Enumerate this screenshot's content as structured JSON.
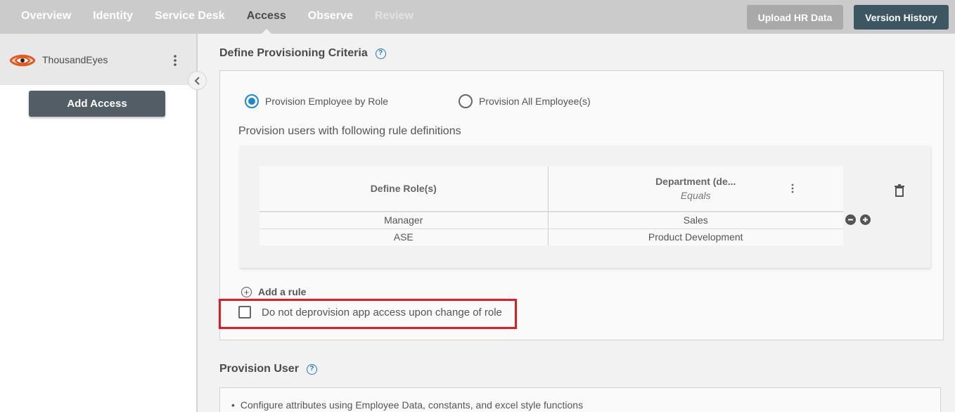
{
  "nav": {
    "items": [
      {
        "label": "Overview",
        "state": "normal"
      },
      {
        "label": "Identity",
        "state": "normal"
      },
      {
        "label": "Service Desk",
        "state": "normal"
      },
      {
        "label": "Access",
        "state": "active"
      },
      {
        "label": "Observe",
        "state": "normal"
      },
      {
        "label": "Review",
        "state": "disabled"
      }
    ],
    "upload_label": "Upload HR Data",
    "version_label": "Version History"
  },
  "sidebar": {
    "app_name": "ThousandEyes",
    "app_logo_icon": "eye-icon",
    "add_access_label": "Add Access"
  },
  "criteria": {
    "title": "Define Provisioning Criteria",
    "help_glyph": "?",
    "radio_options": [
      {
        "label": "Provision Employee by Role",
        "checked": true
      },
      {
        "label": "Provision All Employee(s)",
        "checked": false
      }
    ],
    "caption": "Provision users with following rule definitions",
    "table": {
      "headers": [
        {
          "label": "Define Role(s)",
          "sub": ""
        },
        {
          "label": "Department (de...",
          "sub": "Equals"
        }
      ],
      "rows": [
        [
          "Manager",
          "Sales"
        ],
        [
          "ASE",
          "Product Development"
        ]
      ]
    },
    "add_rule_label": "Add a rule",
    "checkbox": {
      "label": "Do not deprovision app access upon change of role",
      "checked": false
    }
  },
  "provision_user": {
    "title": "Provision User",
    "help_glyph": "?",
    "bullets": [
      "Configure attributes using Employee Data, constants, and excel style functions"
    ]
  },
  "colors": {
    "accent": "#1a8acb",
    "highlight": "#e31b23",
    "version_btn": "#3d5762",
    "upload_btn": "#a9a9a9",
    "logo": "#e8581c"
  }
}
